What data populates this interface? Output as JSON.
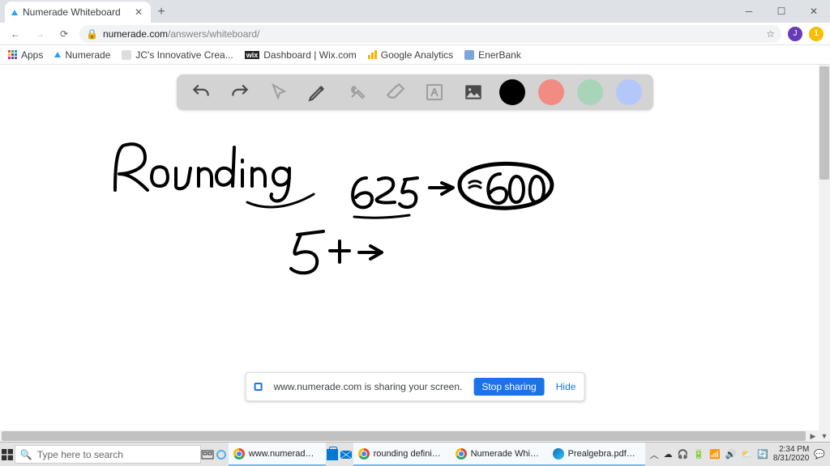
{
  "browser": {
    "tab_title": "Numerade Whiteboard",
    "url_host": "numerade.com",
    "url_path": "/answers/whiteboard/",
    "profile_initial": "J",
    "update_badge": "1"
  },
  "bookmarks": {
    "apps": "Apps",
    "numerade": "Numerade",
    "jc": "JC's Innovative Crea...",
    "wix": "Dashboard | Wix.com",
    "ga": "Google Analytics",
    "enerbank": "EnerBank"
  },
  "toolbar": {
    "undo": "undo",
    "redo": "redo",
    "select": "select",
    "pen": "pen",
    "tools": "tools",
    "eraser": "eraser",
    "text": "text",
    "image": "image"
  },
  "colors": {
    "black": "#000000",
    "red": "#f28b82",
    "green": "#a8d5ba",
    "blue": "#b3c7f9"
  },
  "whiteboard": {
    "title_stroke": "Rounding",
    "expr_1_left": "625",
    "expr_1_right": "≈600",
    "expr_2": "5+"
  },
  "share": {
    "text": "www.numerade.com is sharing your screen.",
    "stop": "Stop sharing",
    "hide": "Hide"
  },
  "taskbar": {
    "search_placeholder": "Type here to search",
    "items": {
      "numerade_site": "www.numerade.c...",
      "rounding": "rounding definiti...",
      "whiteboard": "Numerade White...",
      "prealgebra": "Prealgebra.pdf - ..."
    },
    "time": "2:34 PM",
    "date": "8/31/2020"
  }
}
